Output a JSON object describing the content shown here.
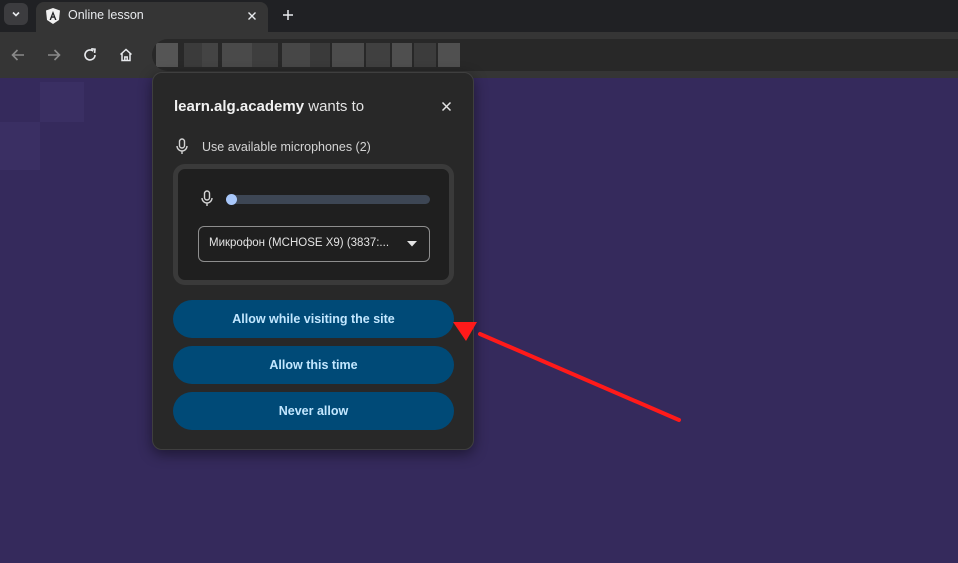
{
  "browser": {
    "tab": {
      "title": "Online lesson",
      "favicon": "letter-a-shield-icon"
    },
    "toolbar": {
      "back_icon": "back-arrow-icon",
      "forward_icon": "forward-arrow-icon",
      "reload_icon": "reload-icon",
      "home_icon": "home-icon"
    },
    "colors": {
      "tabstrip": "#202124",
      "toolbar": "#353535",
      "page": "#352a5c"
    }
  },
  "popup": {
    "domain": "learn.alg.academy",
    "title_suffix": " wants to",
    "permission_label": "Use available microphones (2)",
    "microphone_select": {
      "selected": "Микрофон (MCHOSE X9) (3837:..."
    },
    "buttons": {
      "allow_visit": "Allow while visiting the site",
      "allow_once": "Allow this time",
      "never": "Never allow"
    },
    "colors": {
      "background": "#282828",
      "button": "#004a77",
      "button_text": "#c2e7ff",
      "level_fill": "#a8c7fa"
    }
  },
  "annotation": {
    "type": "red-arrow",
    "color": "#ff1a1a",
    "points_to": "Allow while visiting the site"
  }
}
